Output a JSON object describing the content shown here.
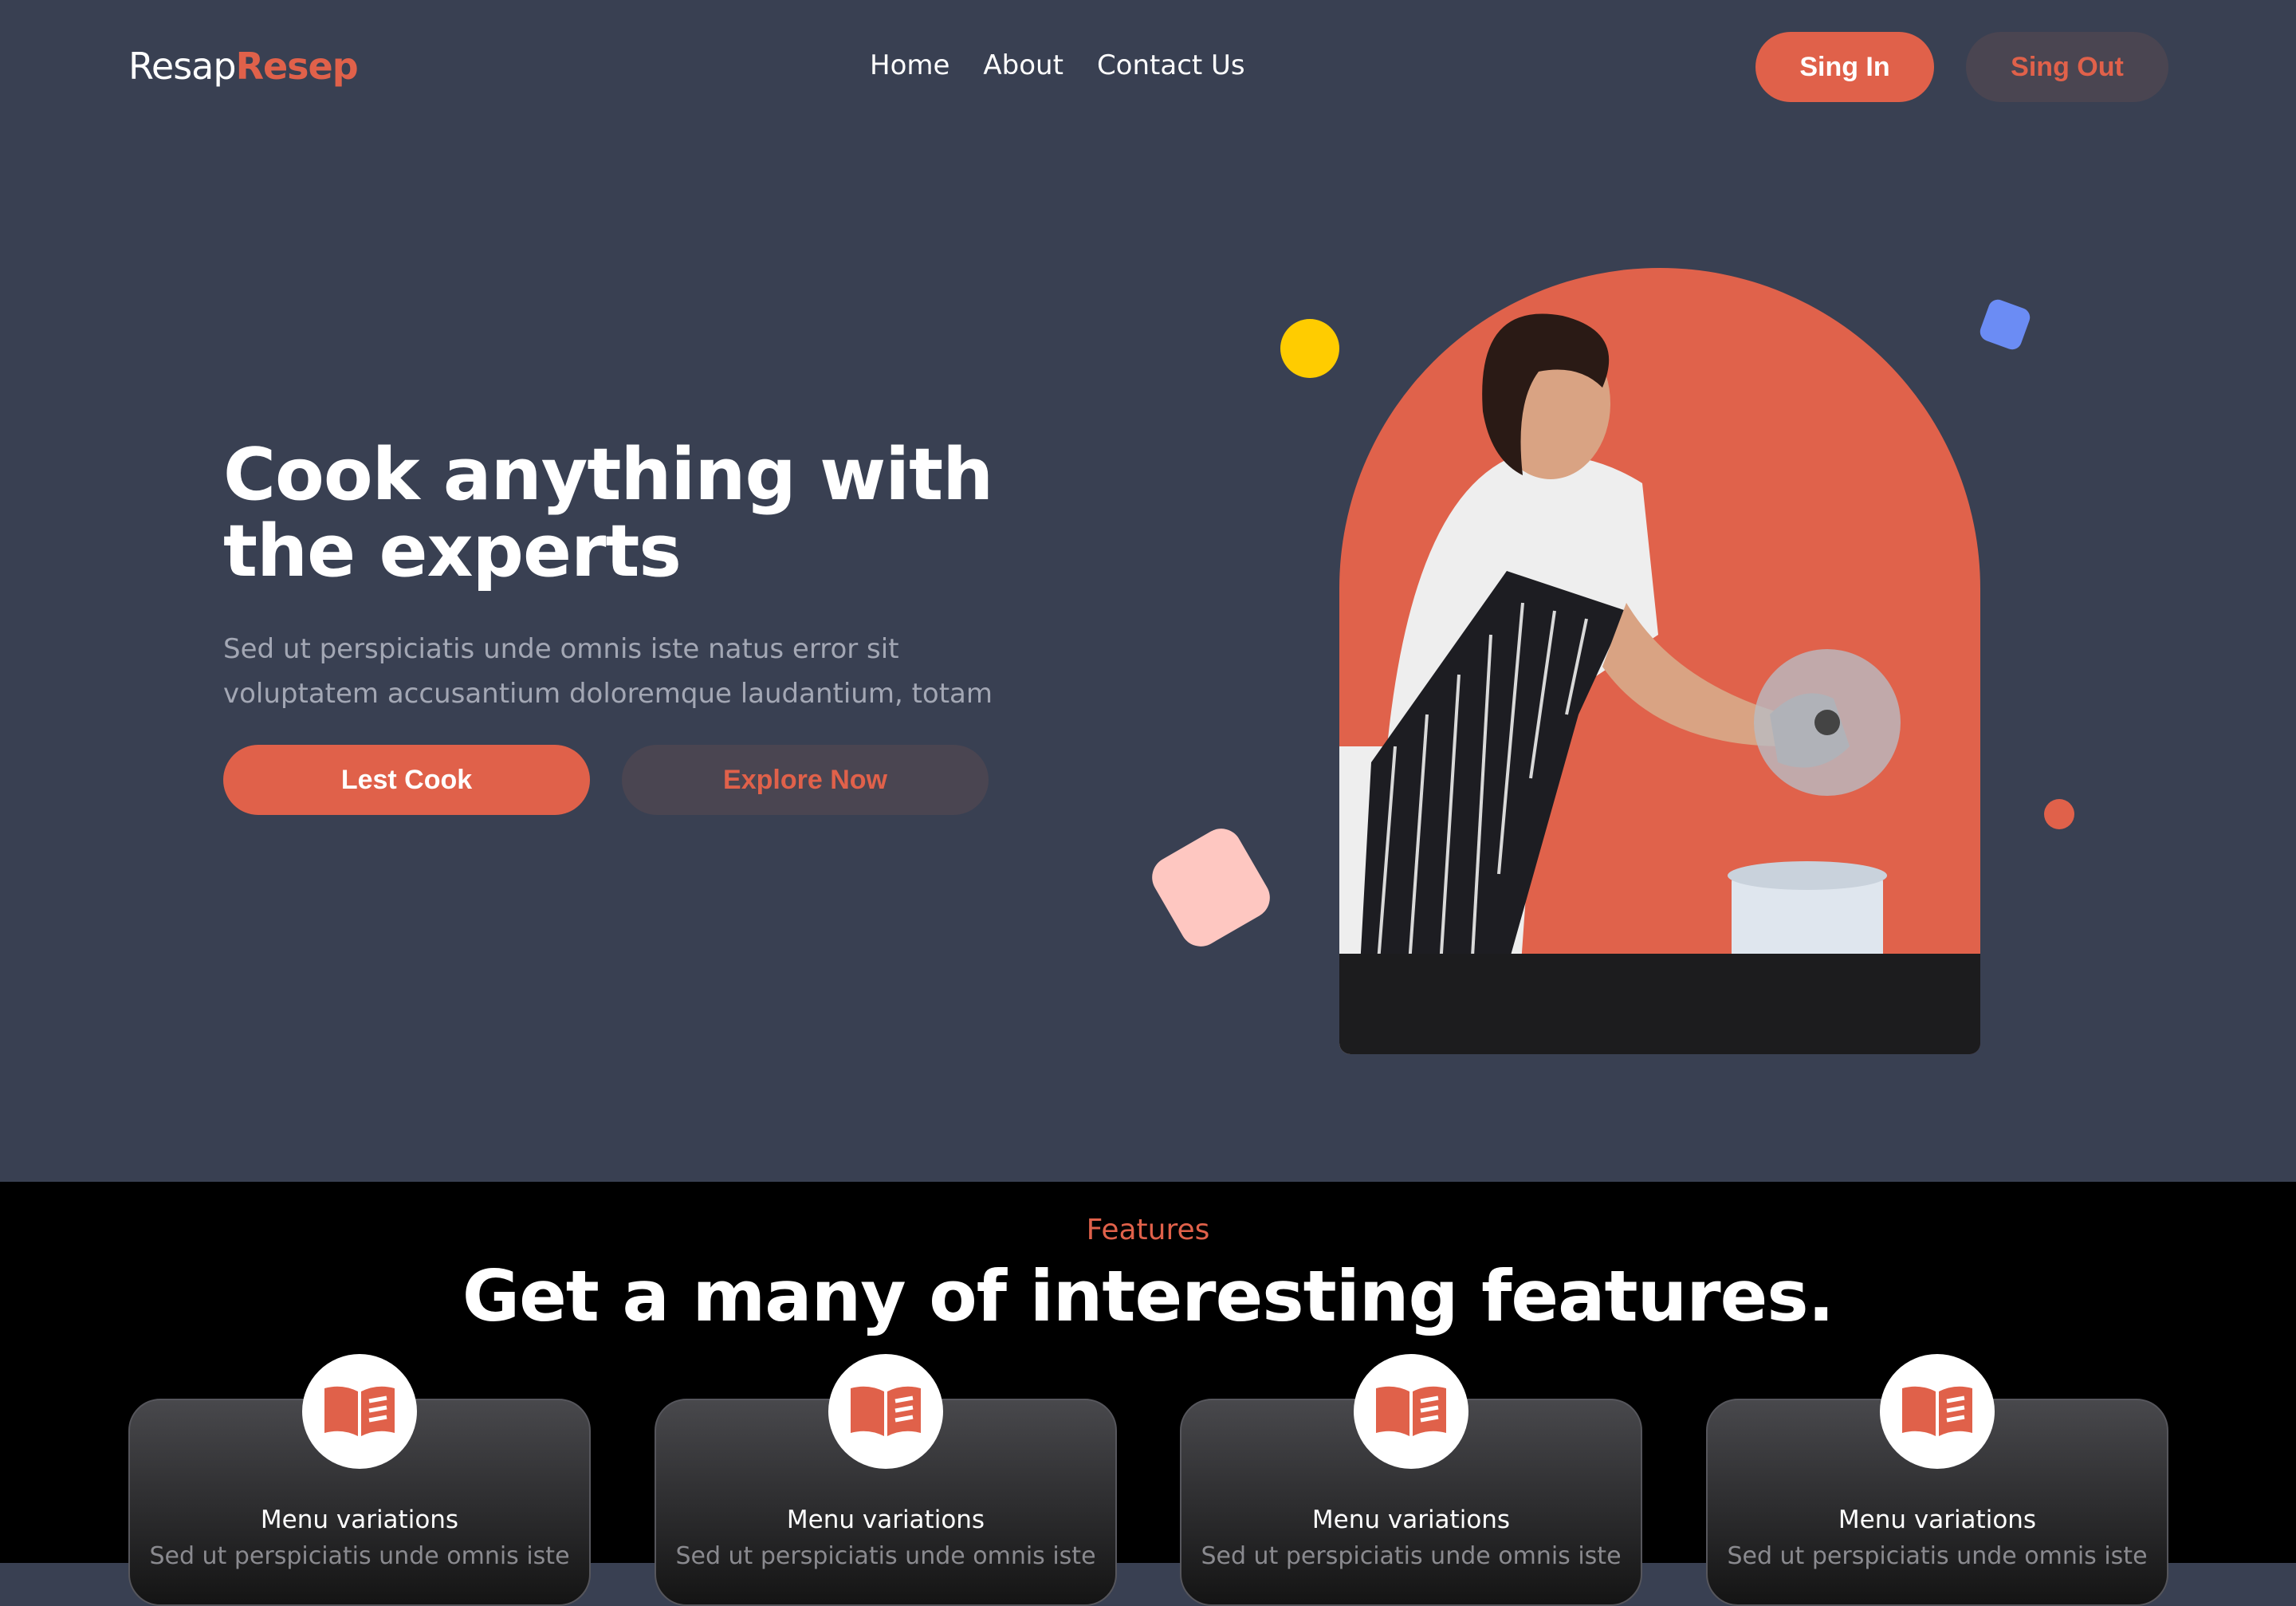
{
  "nav": {
    "logo_part1": "Resap",
    "logo_part2": "Resep",
    "links": [
      "Home",
      "About",
      "Contact Us"
    ],
    "signin_label": "Sing In",
    "signout_label": "Sing Out"
  },
  "hero": {
    "title": "Cook anything with the experts",
    "subtitle": "Sed ut perspiciatis unde omnis iste natus error sit voluptatem accusantium doloremque laudantium, totam",
    "primary_label": "Lest Cook",
    "secondary_label": "Explore Now"
  },
  "features": {
    "eyebrow": "Features",
    "title": "Get a many of interesting features.",
    "cards": [
      {
        "title": "Menu variations",
        "text": "Sed ut perspiciatis unde omnis iste",
        "icon": "book-icon"
      },
      {
        "title": "Menu variations",
        "text": "Sed ut perspiciatis unde omnis iste",
        "icon": "book-icon"
      },
      {
        "title": "Menu variations",
        "text": "Sed ut perspiciatis unde omnis iste",
        "icon": "book-icon"
      },
      {
        "title": "Menu variations",
        "text": "Sed ut perspiciatis unde omnis iste",
        "icon": "book-icon"
      }
    ]
  },
  "colors": {
    "background": "#394052",
    "accent": "#e0614a",
    "features_bg": "#000000"
  }
}
